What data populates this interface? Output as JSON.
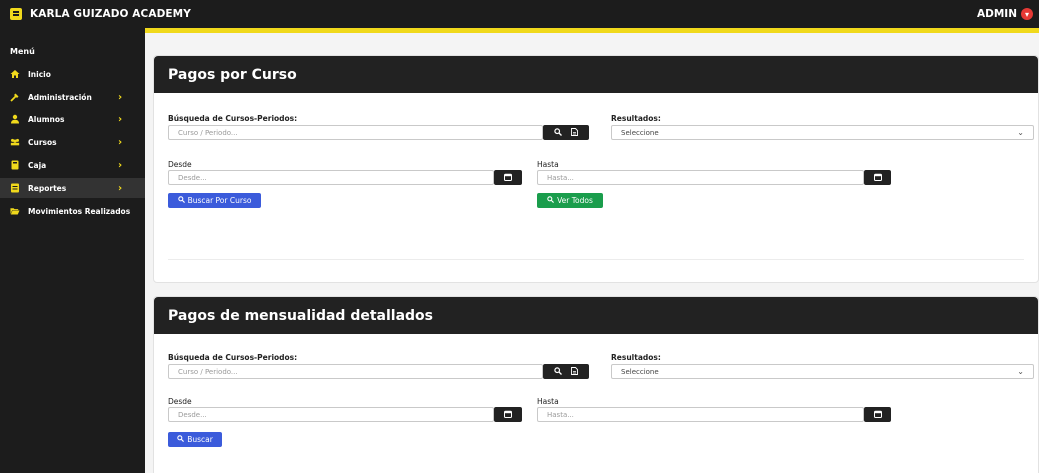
{
  "header": {
    "brand": "KARLA GUIZADO ACADEMY",
    "user": "ADMIN"
  },
  "sidebar": {
    "menu_label": "Menú",
    "items": [
      {
        "label": "Inicio",
        "icon": "home-icon",
        "chevron": false
      },
      {
        "label": "Administración",
        "icon": "tools-icon",
        "chevron": true
      },
      {
        "label": "Alumnos",
        "icon": "user-icon",
        "chevron": true
      },
      {
        "label": "Cursos",
        "icon": "users-group-icon",
        "chevron": true
      },
      {
        "label": "Caja",
        "icon": "cash-icon",
        "chevron": true
      },
      {
        "label": "Reportes",
        "icon": "report-icon",
        "chevron": true,
        "active": true
      },
      {
        "label": "Movimientos Realizados",
        "icon": "folder-open-icon",
        "chevron": false
      }
    ]
  },
  "card1": {
    "title": "Pagos por Curso",
    "search_label": "Búsqueda de Cursos-Periodos:",
    "search_placeholder": "Curso / Periodo...",
    "results_label": "Resultados:",
    "results_value": "Seleccione",
    "desde_label": "Desde",
    "desde_placeholder": "Desde...",
    "hasta_label": "Hasta",
    "hasta_placeholder": "Hasta...",
    "btn_search": "Buscar Por Curso",
    "btn_all": "Ver Todos"
  },
  "card2": {
    "title": "Pagos de mensualidad detallados",
    "search_label": "Búsqueda de Cursos-Periodos:",
    "search_placeholder": "Curso / Periodo...",
    "results_label": "Resultados:",
    "results_value": "Seleccione",
    "desde_label": "Desde",
    "desde_placeholder": "Desde...",
    "hasta_label": "Hasta",
    "hasta_placeholder": "Hasta...",
    "btn_search": "Buscar"
  },
  "colors": {
    "accent": "#f0d91c",
    "dark": "#1c1c1c",
    "primary": "#3b5bdb",
    "success": "#1a9d4c",
    "danger": "#e53935"
  }
}
